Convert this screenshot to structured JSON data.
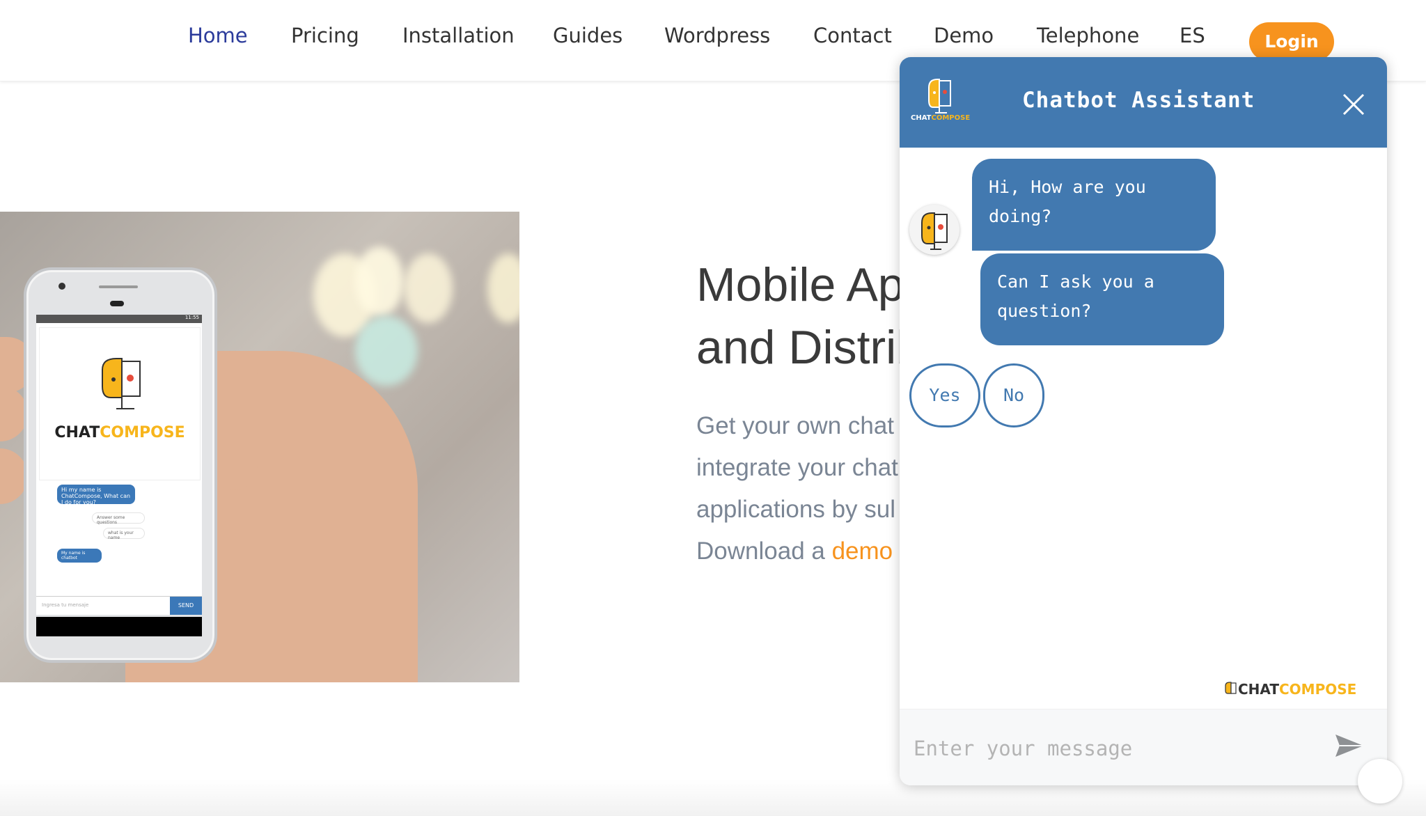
{
  "nav": {
    "items": [
      {
        "label": "Home",
        "active": true
      },
      {
        "label": "Pricing"
      },
      {
        "label": "Installation"
      },
      {
        "label": "Guides"
      },
      {
        "label": "Wordpress"
      },
      {
        "label": "Contact"
      },
      {
        "label": "Demo"
      },
      {
        "label": "Telephone"
      },
      {
        "label": "ES"
      }
    ],
    "login_label": "Login"
  },
  "hero": {
    "title_line1": "Mobile Ap",
    "title_line2": "and Distrib",
    "body_line1": "Get your own chat",
    "body_line2": "integrate your chat",
    "body_line3": "applications by sul",
    "body_line4_prefix": "Download a ",
    "body_line4_link": "demo"
  },
  "phone": {
    "brand_part1": "CHAT",
    "brand_part2": "COMPOSE",
    "status_time": "11:55",
    "bubble1": "Hi my name is ChatCompose, What can I do for you?",
    "bubble2": "Answer some questions",
    "bubble3": "what is your name",
    "bubble4": "My name is chatbot",
    "input_placeholder": "Ingresa tu mensaje",
    "send_label": "SEND"
  },
  "chat": {
    "title": "Chatbot Assistant",
    "logo_part1": "CHAT",
    "logo_part2": "COMPOSE",
    "messages": [
      {
        "text": "Hi, How are you doing?"
      },
      {
        "text": "Can I ask you a question?"
      }
    ],
    "choices": [
      "Yes",
      "No"
    ],
    "brand_part1": "CHAT",
    "brand_part2": "COMPOSE",
    "input_placeholder": "Enter your message"
  },
  "colors": {
    "accent_blue": "#4279b0",
    "nav_active": "#2b3b9b",
    "orange": "#f7931e",
    "brand_yellow": "#f7b51c"
  },
  "icons": {
    "close": "close-icon",
    "send": "send-icon",
    "bot": "robot-avatar-icon",
    "scroll": "scroll-up-icon"
  }
}
